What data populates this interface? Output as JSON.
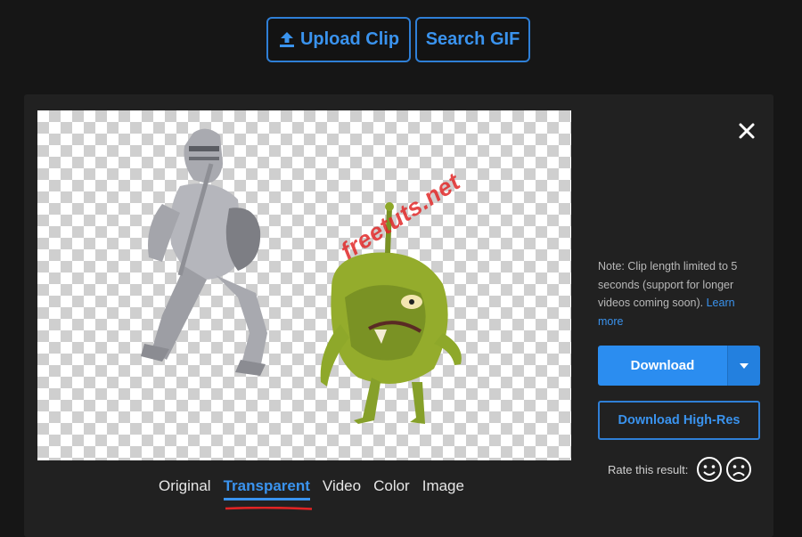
{
  "toolbar": {
    "upload_label": "Upload Clip",
    "search_gif_label": "Search GIF",
    "upload_icon": "upload-icon"
  },
  "preview": {
    "watermark": "freetuts.net",
    "close_icon": "close-icon"
  },
  "tabs": [
    {
      "label": "Original",
      "active": false
    },
    {
      "label": "Transparent",
      "active": true
    },
    {
      "label": "Video",
      "active": false
    },
    {
      "label": "Color",
      "active": false
    },
    {
      "label": "Image",
      "active": false
    }
  ],
  "sidebar": {
    "note_text": "Note: Clip length limited to 5 seconds (support for longer videos coming soon).",
    "note_link": "Learn more",
    "download_label": "Download",
    "download_caret_icon": "chevron-down-icon",
    "download_hires_label": "Download High-Res",
    "rate_label": "Rate this result:",
    "happy_icon": "smile-icon",
    "sad_icon": "frown-icon"
  },
  "colors": {
    "accent": "#3a93ee",
    "primary_button": "#2b8df0",
    "panel": "#212121",
    "background": "#161616",
    "annotation": "#e02424"
  }
}
